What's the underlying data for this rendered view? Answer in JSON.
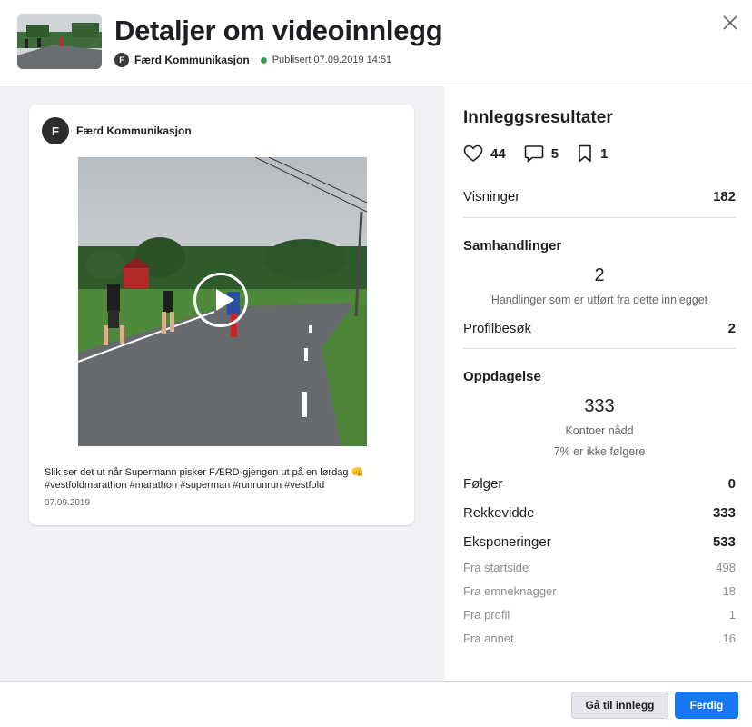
{
  "header": {
    "title": "Detaljer om videoinnlegg",
    "page_name": "Færd Kommunikasjon",
    "published": "Publisert 07.09.2019 14:51",
    "logo_letter": "F"
  },
  "post": {
    "page_name": "Færd Kommunikasjon",
    "avatar_letter": "F",
    "caption": "Slik ser det ut når Supermann pisker FÆRD-gjengen ut på en lørdag 👊 #vestfoldmarathon #marathon #superman #runrunrun #vestfold",
    "date": "07.09.2019"
  },
  "results": {
    "title": "Innleggsresultater",
    "likes": "44",
    "comments": "5",
    "saves": "1",
    "views_label": "Visninger",
    "views_value": "182"
  },
  "interactions": {
    "title": "Samhandlinger",
    "total": "2",
    "description": "Handlinger som er utført fra dette innlegget",
    "profile_visits_label": "Profilbesøk",
    "profile_visits_value": "2"
  },
  "discovery": {
    "title": "Oppdagelse",
    "accounts_reached": "333",
    "accounts_reached_label": "Kontoer nådd",
    "non_followers": "7% er ikke følgere",
    "follows_label": "Følger",
    "follows_value": "0",
    "reach_label": "Rekkevidde",
    "reach_value": "333",
    "impressions_label": "Eksponeringer",
    "impressions_value": "533",
    "sources": [
      {
        "label": "Fra startside",
        "value": "498"
      },
      {
        "label": "Fra emneknagger",
        "value": "18"
      },
      {
        "label": "Fra profil",
        "value": "1"
      },
      {
        "label": "Fra annet",
        "value": "16"
      }
    ]
  },
  "footer": {
    "go_to_post": "Gå til innlegg",
    "done": "Ferdig"
  },
  "colors": {
    "accent": "#1877f2",
    "published_dot": "#31a24c"
  }
}
